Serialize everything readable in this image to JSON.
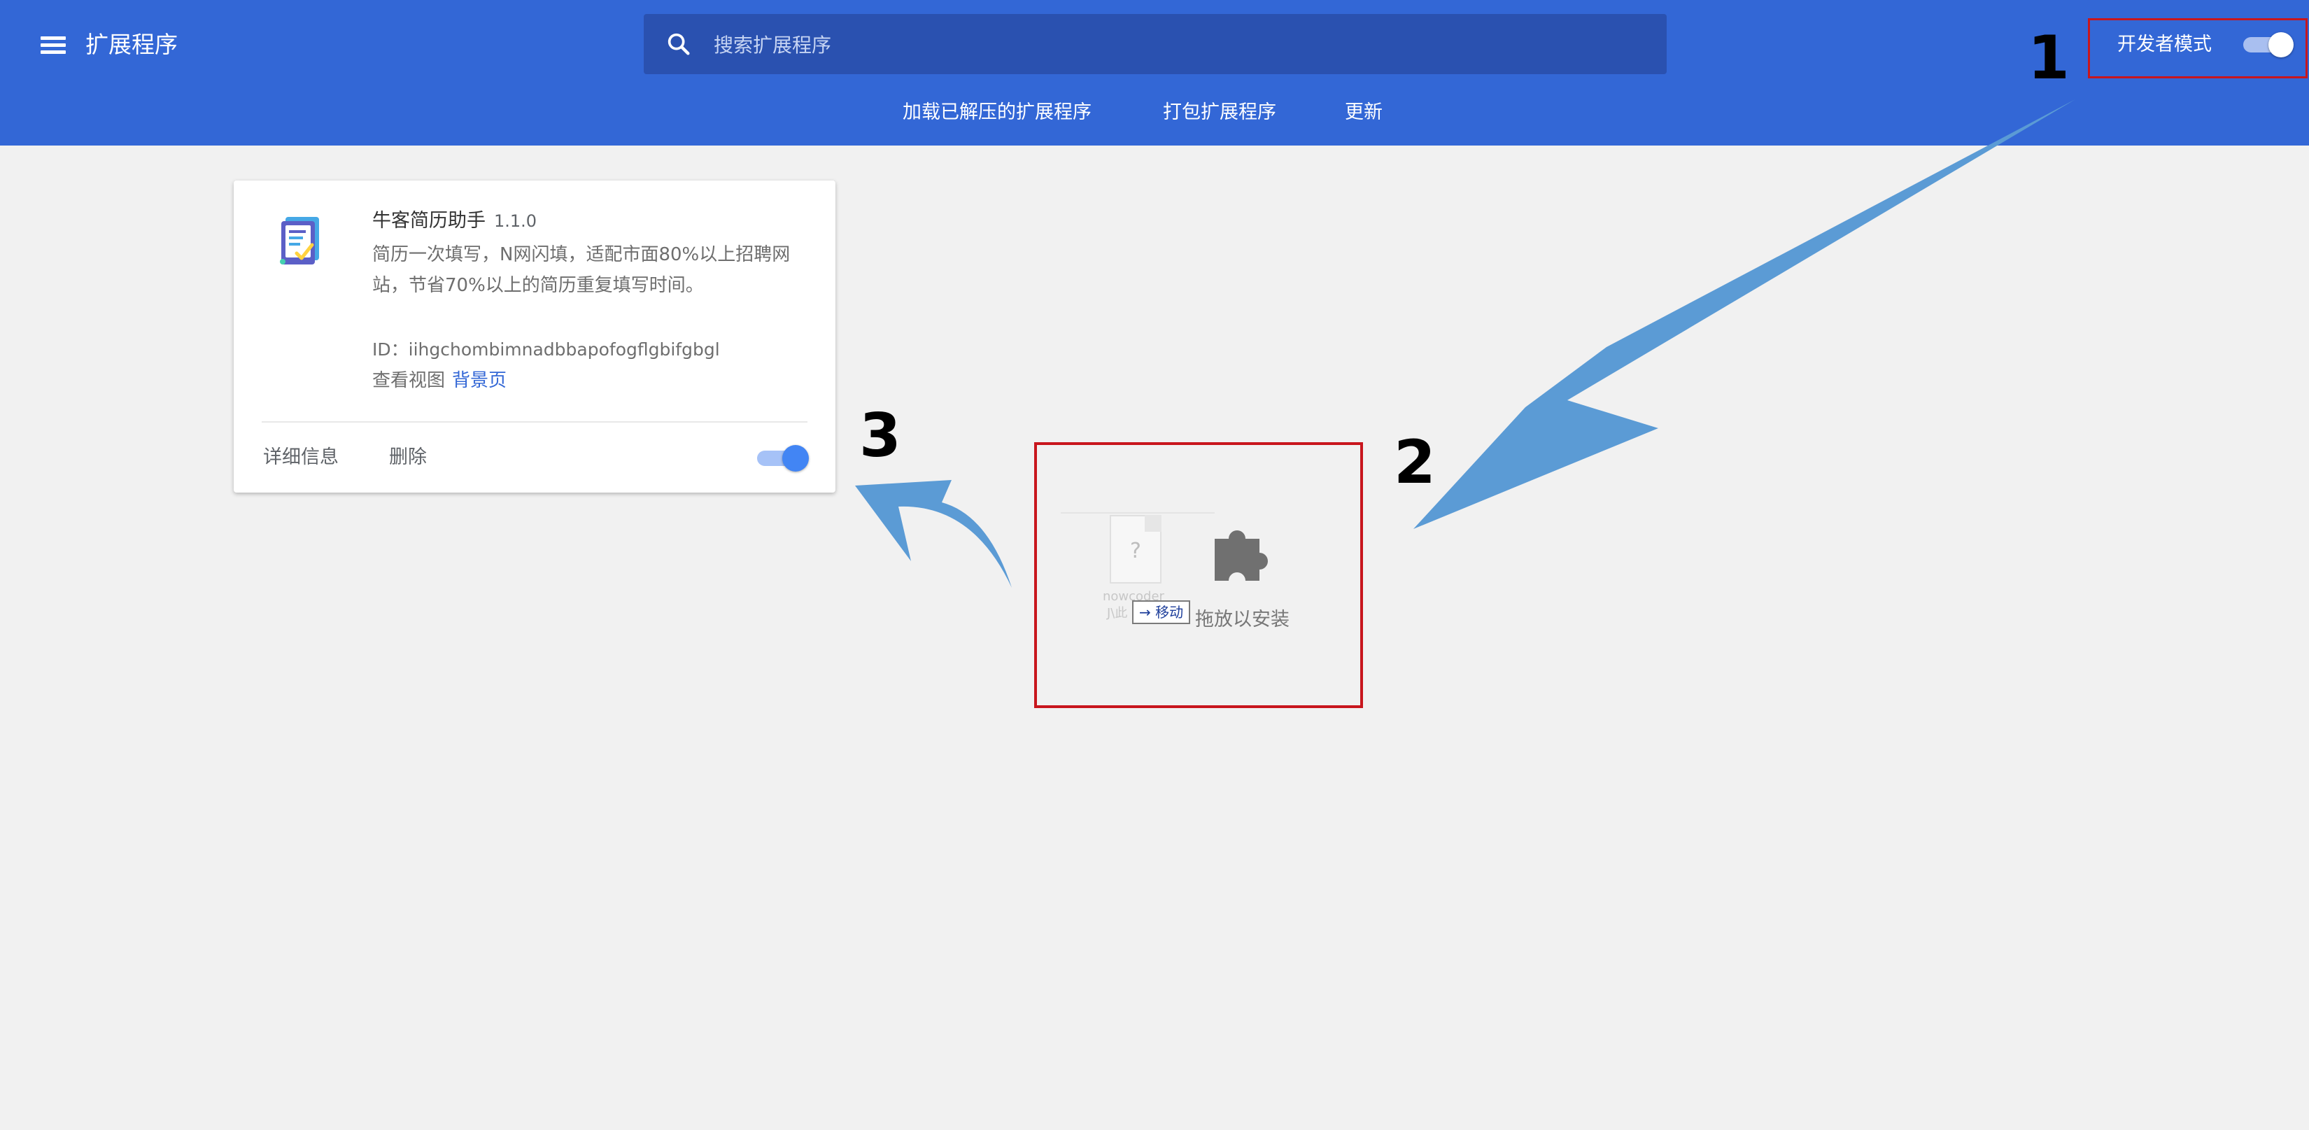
{
  "header": {
    "title": "扩展程序",
    "search_placeholder": "搜索扩展程序",
    "links": [
      "加载已解压的扩展程序",
      "打包扩展程序",
      "更新"
    ],
    "dev_mode_label": "开发者模式",
    "dev_mode_on": true
  },
  "extension": {
    "name": "牛客简历助手",
    "version": "1.1.0",
    "description": "简历一次填写，N网闪填，适配市面80%以上招聘网站，节省70%以上的简历重复填写时间。",
    "id_text": "ID：iihgchombimnadbbapofogflgbifgbgl",
    "views_label": "查看视图",
    "views_link": "背景页",
    "details_label": "详细信息",
    "remove_label": "删除",
    "enabled": true
  },
  "drop_zone": {
    "file_name": "nowcoder",
    "file_name_sub": "J\\此",
    "move_label": "→ 移动",
    "install_hint": "拖放以安装"
  },
  "annotations": {
    "step1": "1",
    "step2": "2",
    "step3": "3"
  },
  "colors": {
    "header": "#3367d6",
    "search": "#2a51b0",
    "highlight_box": "#c8161d",
    "arrow": "#5b9bd5",
    "link": "#3367d6"
  }
}
